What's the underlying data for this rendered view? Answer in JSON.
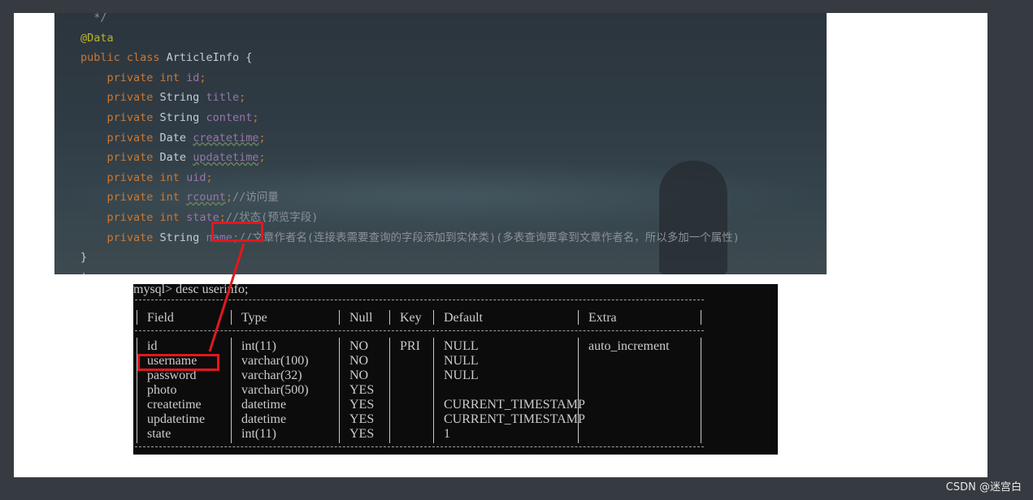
{
  "editor": {
    "lines": [
      "  */",
      "@Data",
      "public class ArticleInfo {",
      "private int id;",
      "private String title;",
      "private String content;",
      "private Date createtime;",
      "private Date updatetime;",
      "private int uid;",
      "private int rcount;//访问量",
      "private int state;//状态(预览字段)",
      "private String name;//文章作者名(连接表需要查询的字段添加到实体类)(多表查询要拿到文章作者名，所以多加一个属性)",
      "}"
    ],
    "annotation": "@Data",
    "class_decl": "public class ArticleInfo {",
    "fields": [
      {
        "type": "int",
        "name": "id",
        "comment": ""
      },
      {
        "type": "String",
        "name": "title",
        "comment": ""
      },
      {
        "type": "String",
        "name": "content",
        "comment": ""
      },
      {
        "type": "Date",
        "name": "createtime",
        "comment": ""
      },
      {
        "type": "Date",
        "name": "updatetime",
        "comment": ""
      },
      {
        "type": "int",
        "name": "uid",
        "comment": ""
      },
      {
        "type": "int",
        "name": "rcount",
        "comment": "//访问量"
      },
      {
        "type": "int",
        "name": "state",
        "comment": "//状态(预览字段)"
      },
      {
        "type": "String",
        "name": "name",
        "comment": "//文章作者名(连接表需要查询的字段添加到实体类)(多表查询要拿到文章作者名，所以多加一个属性)"
      }
    ],
    "closing": "}"
  },
  "terminal": {
    "command": "mysql> desc userinfo;",
    "headers": [
      "Field",
      "Type",
      "Null",
      "Key",
      "Default",
      "Extra"
    ],
    "rows": [
      [
        "id",
        "int(11)",
        "NO",
        "PRI",
        "NULL",
        "auto_increment"
      ],
      [
        "username",
        "varchar(100)",
        "NO",
        "",
        "NULL",
        ""
      ],
      [
        "password",
        "varchar(32)",
        "NO",
        "",
        "NULL",
        ""
      ],
      [
        "photo",
        "varchar(500)",
        "YES",
        "",
        "",
        ""
      ],
      [
        "createtime",
        "datetime",
        "YES",
        "",
        "CURRENT_TIMESTAMP",
        ""
      ],
      [
        "updatetime",
        "datetime",
        "YES",
        "",
        "CURRENT_TIMESTAMP",
        ""
      ],
      [
        "state",
        "int(11)",
        "YES",
        "",
        "1",
        ""
      ]
    ]
  },
  "highlight_color": "#e1181e",
  "footer": {
    "watermark": "CSDN @迷宫白"
  }
}
